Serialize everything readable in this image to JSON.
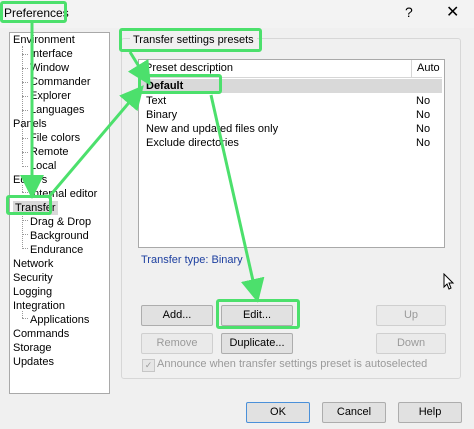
{
  "window": {
    "title": "Preferences",
    "help_glyph": "?",
    "close_glyph": "✕"
  },
  "tree": {
    "nodes": [
      {
        "label": "Environment"
      },
      {
        "label": "Interface"
      },
      {
        "label": "Window"
      },
      {
        "label": "Commander"
      },
      {
        "label": "Explorer"
      },
      {
        "label": "Languages"
      },
      {
        "label": "Panels"
      },
      {
        "label": "File colors"
      },
      {
        "label": "Remote"
      },
      {
        "label": "Local"
      },
      {
        "label": "Editors"
      },
      {
        "label": "Internal editor"
      },
      {
        "label": "Transfer",
        "selected": true
      },
      {
        "label": "Drag & Drop"
      },
      {
        "label": "Background"
      },
      {
        "label": "Endurance"
      },
      {
        "label": "Network"
      },
      {
        "label": "Security"
      },
      {
        "label": "Logging"
      },
      {
        "label": "Integration"
      },
      {
        "label": "Applications"
      },
      {
        "label": "Commands"
      },
      {
        "label": "Storage"
      },
      {
        "label": "Updates"
      }
    ]
  },
  "presets": {
    "group_label": "Transfer settings presets",
    "columns": {
      "description": "Preset description",
      "auto": "Auto"
    },
    "rows": [
      {
        "description": "Default",
        "auto": "",
        "selected": true
      },
      {
        "description": "Text",
        "auto": "No"
      },
      {
        "description": "Binary",
        "auto": "No"
      },
      {
        "description": "New and updated files only",
        "auto": "No"
      },
      {
        "description": "Exclude directories",
        "auto": "No"
      }
    ],
    "transfer_type": "Transfer type: Binary"
  },
  "buttons": {
    "add": "Add...",
    "edit": "Edit...",
    "up": "Up",
    "remove": "Remove",
    "duplicate": "Duplicate...",
    "down": "Down"
  },
  "checkbox": {
    "label": "Announce when transfer settings preset is autoselected",
    "checked": true,
    "check_glyph": "✓"
  },
  "footer": {
    "ok": "OK",
    "cancel": "Cancel",
    "help": "Help"
  },
  "colors": {
    "highlight": "#4ce06c",
    "selection": "#d9d9d9",
    "link_text": "#1e40a0"
  }
}
